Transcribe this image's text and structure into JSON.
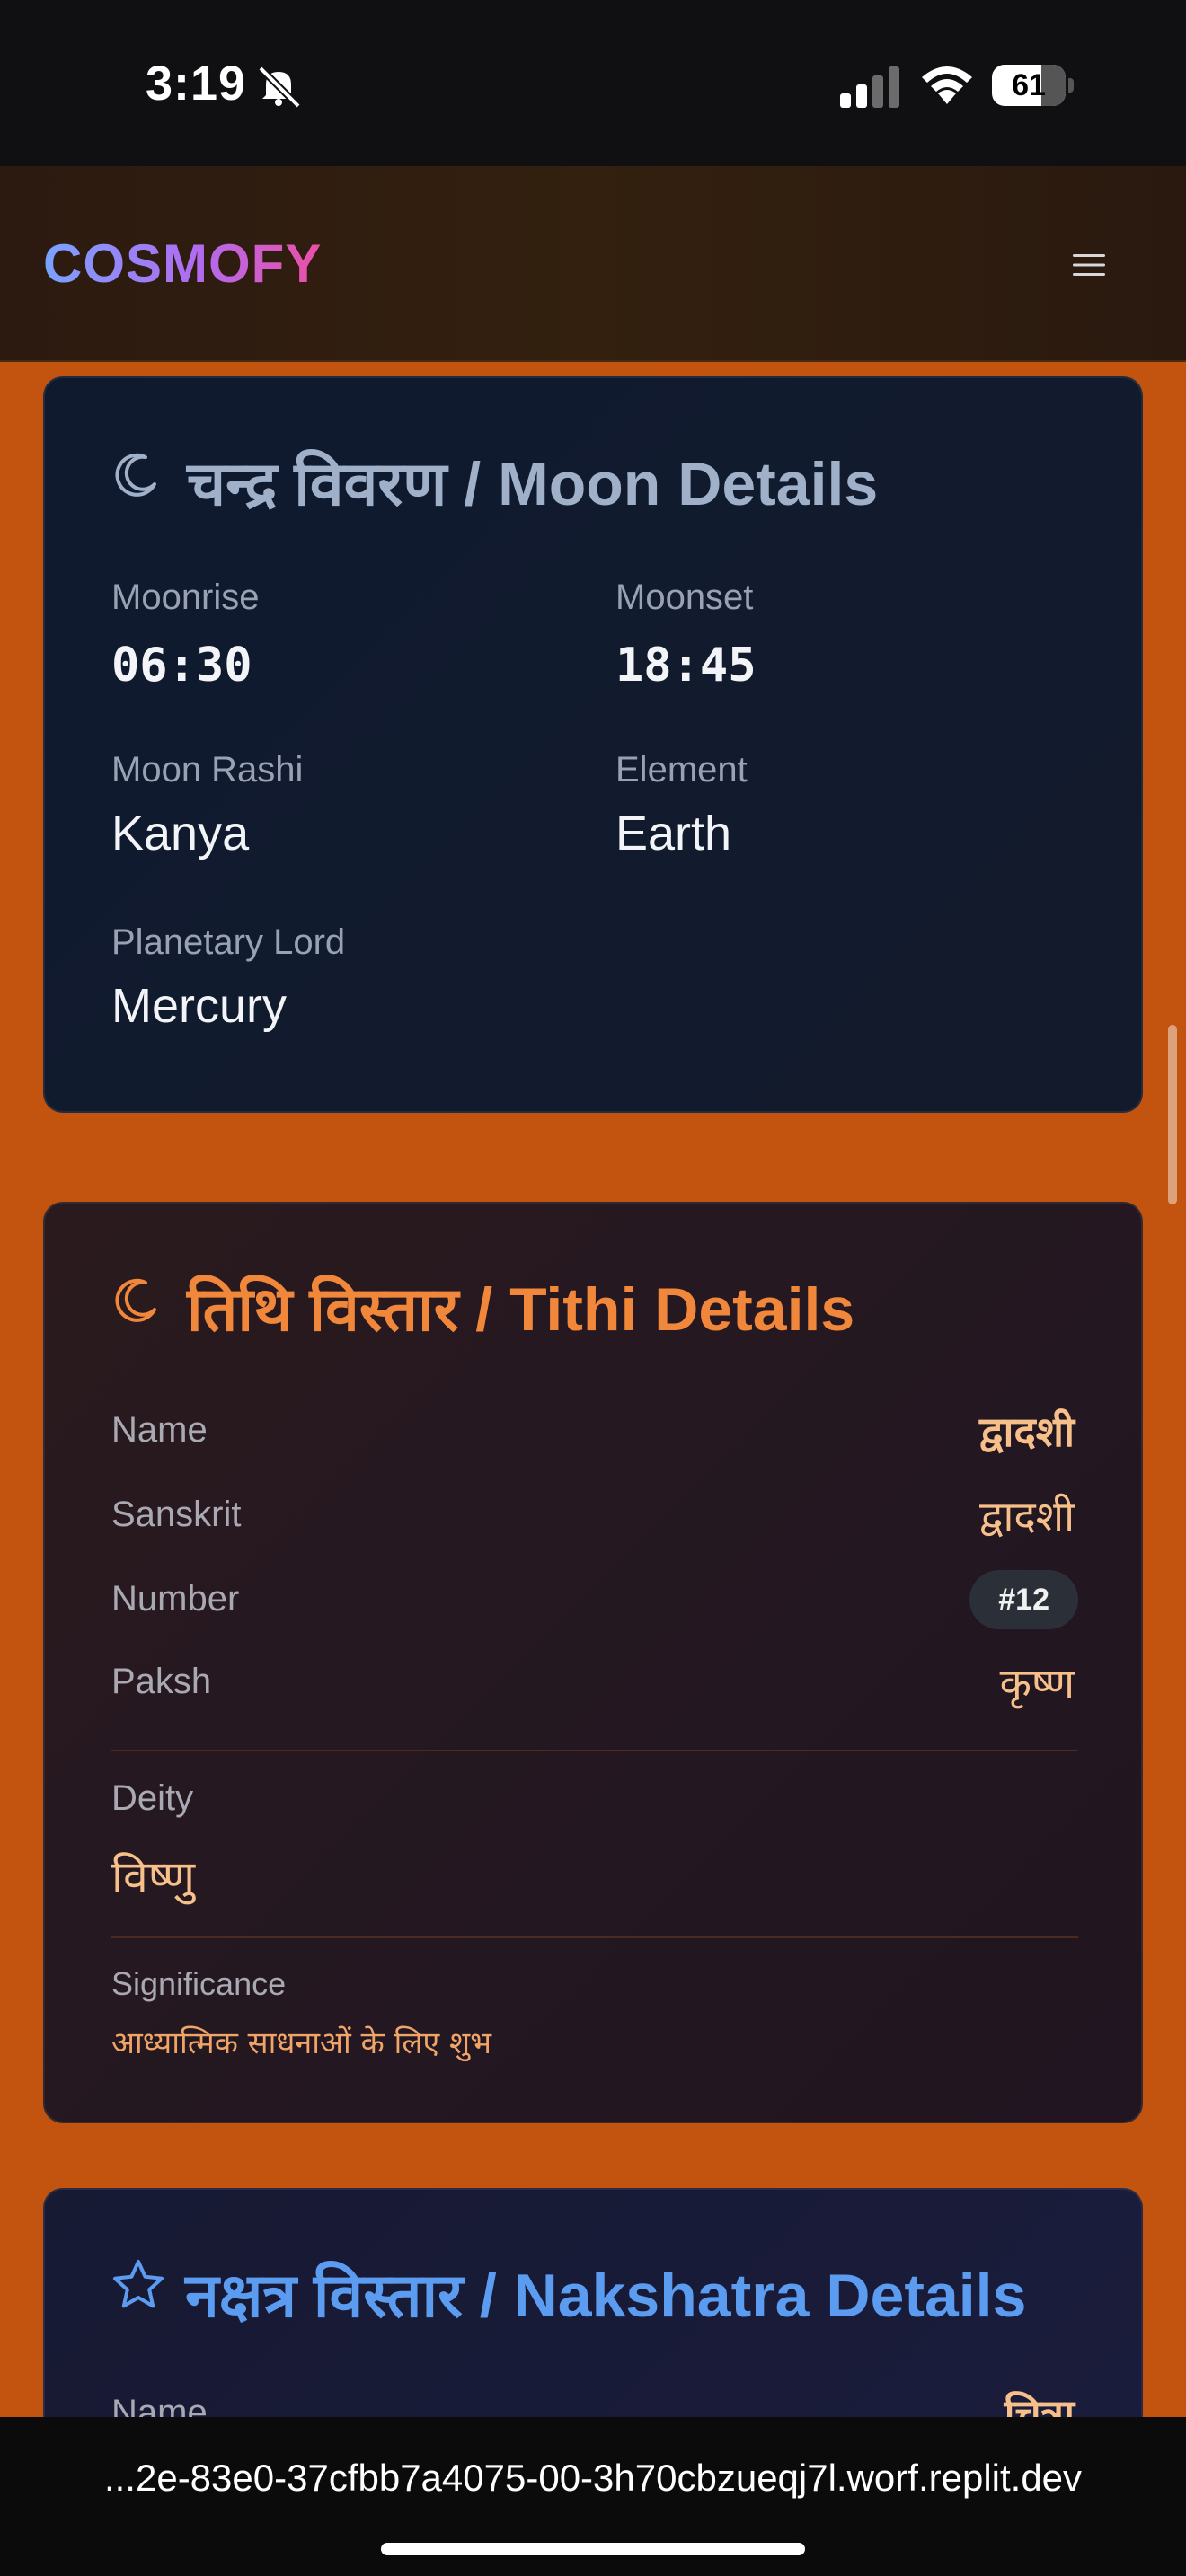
{
  "status_bar": {
    "time": "3:19",
    "battery": "61"
  },
  "header": {
    "logo": "COSMOFY",
    "menu_icon": "hamburger-menu-icon"
  },
  "moon_card": {
    "title": "चन्द्र विवरण / Moon Details",
    "icon": "crescent-moon-icon",
    "moonrise_label": "Moonrise",
    "moonrise_value": "06:30",
    "moonset_label": "Moonset",
    "moonset_value": "18:45",
    "rashi_label": "Moon Rashi",
    "rashi_value": "Kanya",
    "element_label": "Element",
    "element_value": "Earth",
    "lord_label": "Planetary Lord",
    "lord_value": "Mercury"
  },
  "tithi_card": {
    "title": "तिथि विस्तार / Tithi Details",
    "icon": "crescent-moon-icon",
    "name_label": "Name",
    "name_value": "द्वादशी",
    "sanskrit_label": "Sanskrit",
    "sanskrit_value": "द्वादशी",
    "number_label": "Number",
    "number_value": "#12",
    "paksh_label": "Paksh",
    "paksh_value": "कृष्ण",
    "deity_label": "Deity",
    "deity_value": "विष्णु",
    "significance_label": "Significance",
    "significance_value": "आध्यात्मिक साधनाओं के लिए शुभ"
  },
  "nakshatra_card": {
    "title": "नक्षत्र विस्तार / Nakshatra Details",
    "icon": "star-outline-icon",
    "name_label": "Name",
    "name_value": "चित्रा"
  },
  "browser": {
    "url": "...2e-83e0-37cfbb7a4075-00-3h70cbzueqj7l.worf.replit.dev"
  },
  "colors": {
    "page_bg": "#c2540f",
    "moon_title": "#9fb0c8",
    "tithi_title": "#f0873b",
    "nakshatra_title": "#5b9cf0"
  }
}
